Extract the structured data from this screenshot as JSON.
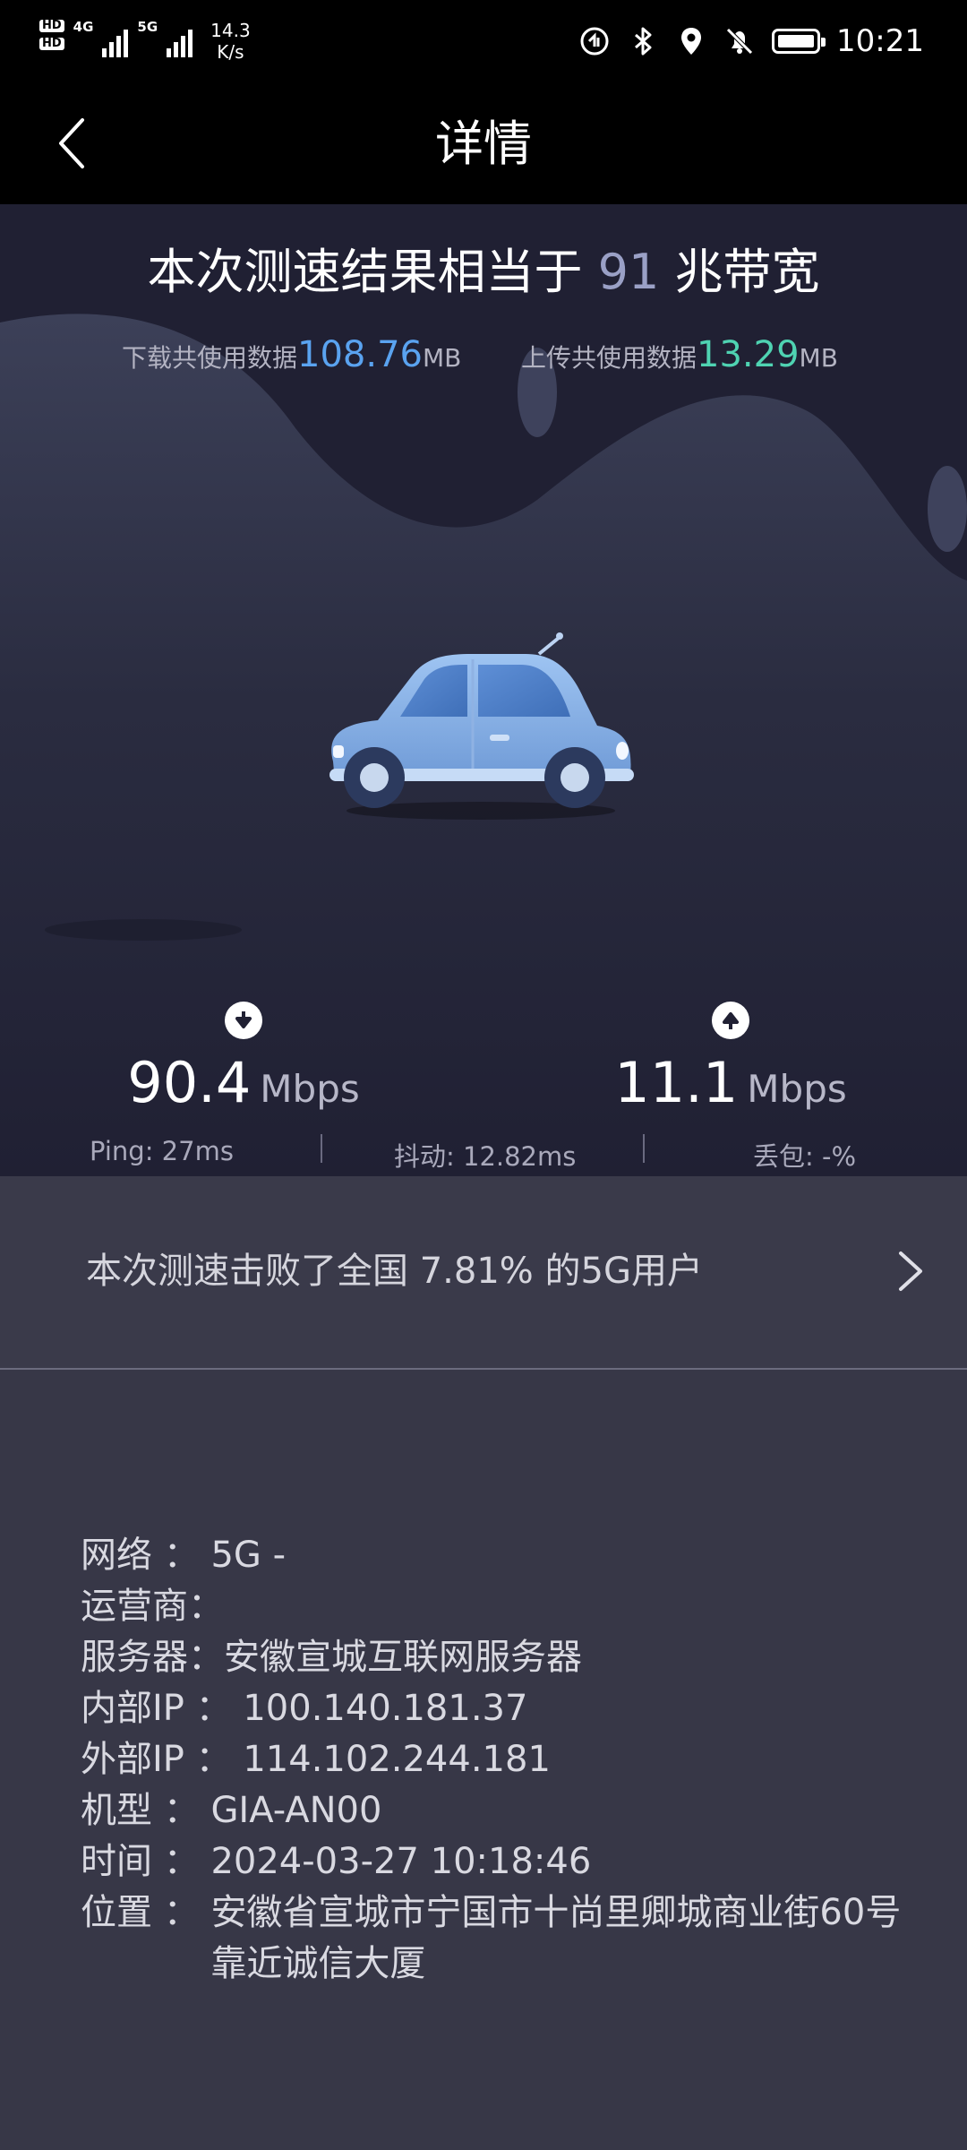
{
  "status_bar": {
    "hd1": "HD",
    "hd2": "HD",
    "net1": "4G",
    "net2": "5G",
    "speed_value": "14.3",
    "speed_unit": "K/s",
    "time": "10:21"
  },
  "app_bar": {
    "title": "详情"
  },
  "result": {
    "title_prefix": "本次测速结果相当于",
    "bandwidth": "91",
    "title_suffix": "兆带宽"
  },
  "usage": {
    "download_label": "下载共使用数据",
    "download_value": "108.76",
    "download_unit": "MB",
    "upload_label": "上传共使用数据",
    "upload_value": "13.29",
    "upload_unit": "MB"
  },
  "speeds": {
    "download_value": "90.4",
    "download_unit": "Mbps",
    "upload_value": "11.1",
    "upload_unit": "Mbps"
  },
  "metrics": {
    "ping": "Ping:  27ms",
    "jitter": "抖动:  12.82ms",
    "loss": "丢包:  -%"
  },
  "rank": {
    "text": "本次测速击败了全国 7.81% 的5G用户"
  },
  "info": {
    "network_label": "网络 ： ",
    "network_value": "5G -",
    "carrier_label": "运营商：",
    "carrier_value": "",
    "server_label": "服务器：",
    "server_value": "安徽宣城互联网服务器",
    "internal_ip_label": "内部IP ： ",
    "internal_ip_value": "100.140.181.37",
    "external_ip_label": "外部IP ： ",
    "external_ip_value": "114.102.244.181",
    "model_label": "机型 ： ",
    "model_value": "GIA-AN00",
    "time_label": "时间 ： ",
    "time_value": "2024-03-27 10:18:46",
    "location_label": "位置 ： ",
    "location_value": "安徽省宣城市宁国市十尚里卿城商业街60号靠近诚信大厦"
  },
  "colors": {
    "download_accent": "#5aa3f0",
    "upload_accent": "#4fd3b2",
    "hero_bg": "#202033",
    "panel_bg": "#373747"
  },
  "icons": {
    "back": "back-arrow-icon",
    "download": "download-arrow-icon",
    "upload": "upload-arrow-icon",
    "chevron": "chevron-right-icon"
  }
}
